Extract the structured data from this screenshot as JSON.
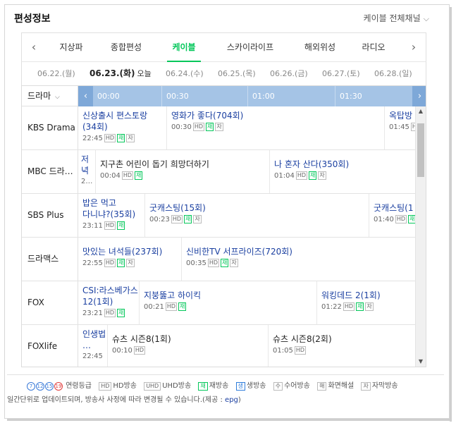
{
  "header": {
    "title": "편성정보",
    "channel_select": "케이블 전체채널"
  },
  "categories": [
    {
      "label": "지상파",
      "active": false
    },
    {
      "label": "종합편성",
      "active": false
    },
    {
      "label": "케이블",
      "active": true
    },
    {
      "label": "스카이라이프",
      "active": false
    },
    {
      "label": "해외위성",
      "active": false
    },
    {
      "label": "라디오",
      "active": false
    }
  ],
  "dates": [
    {
      "label": "06.22.(월)"
    },
    {
      "label": "06.23.(화)",
      "today_label": "오늘"
    },
    {
      "label": "06.24.(수)"
    },
    {
      "label": "06.25.(목)"
    },
    {
      "label": "06.26.(금)"
    },
    {
      "label": "06.27.(토)"
    },
    {
      "label": "06.28.(일)"
    }
  ],
  "grid": {
    "genre": "드라마",
    "times": [
      "00:00",
      "00:30",
      "01:00",
      "01:30"
    ],
    "rows": [
      {
        "channel": "KBS Drama",
        "programs": [
          {
            "title": "신상출시 편스토랑(34회)",
            "time": "22:45",
            "badges": [
              "HD",
              "재",
              "자"
            ]
          },
          {
            "title": "영화가 좋다(704회)",
            "time": "00:30",
            "badges": [
              "HD",
              "재",
              "자"
            ]
          },
          {
            "title": "옥탑방",
            "time": "01:45",
            "badges": [
              "HD"
            ]
          }
        ]
      },
      {
        "channel": "MBC 드라…",
        "programs": [
          {
            "title": "저녁",
            "time": "2…",
            "badges": []
          },
          {
            "title": "지구촌 어린이 돕기 희망더하기",
            "time": "00:04",
            "badges": [
              "HD",
              "재"
            ]
          },
          {
            "title": "나 혼자 산다(350회)",
            "time": "01:04",
            "badges": [
              "HD",
              "재",
              "자"
            ]
          }
        ]
      },
      {
        "channel": "SBS Plus",
        "programs": [
          {
            "title": "밥은 먹고 다니냐?(35회)",
            "time": "23:11",
            "badges": [
              "HD",
              "재"
            ]
          },
          {
            "title": "굿캐스팅(15회)",
            "time": "00:23",
            "badges": [
              "HD",
              "재",
              "자"
            ]
          },
          {
            "title": "굿캐스팅(1",
            "time": "01:40",
            "badges": [
              "HD",
              "재"
            ]
          }
        ]
      },
      {
        "channel": "드라맥스",
        "programs": [
          {
            "title": "맛있는 녀석들(237회)",
            "time": "22:55",
            "badges": [
              "HD",
              "재",
              "자"
            ]
          },
          {
            "title": "신비한TV 서프라이즈(720회)",
            "time": "00:35",
            "badges": [
              "HD",
              "재",
              "자"
            ]
          }
        ]
      },
      {
        "channel": "FOX",
        "programs": [
          {
            "title": "CSI:라스베가스 12(1회)",
            "time": "23:21",
            "badges": [
              "HD",
              "재"
            ]
          },
          {
            "title": "지붕뚫고 하이킥",
            "time": "00:21",
            "badges": [
              "HD",
              "재"
            ]
          },
          {
            "title": "워킹데드 2(1회)",
            "time": "01:22",
            "badges": [
              "HD",
              "재",
              "자"
            ]
          }
        ]
      },
      {
        "channel": "FOXlife",
        "programs": [
          {
            "title": "인생법…",
            "time": "22:45",
            "badges": []
          },
          {
            "title": "슈츠 시즌8(1회)",
            "time": "00:10",
            "badges": [
              "HD"
            ]
          },
          {
            "title": "슈츠 시즌8(2회)",
            "time": "01:05",
            "badges": [
              "HD"
            ]
          }
        ]
      }
    ]
  },
  "legend": {
    "ages": [
      "7",
      "12",
      "15",
      "19"
    ],
    "age_label": "연령등급",
    "items": [
      {
        "badge": "HD",
        "label": "HD방송"
      },
      {
        "badge": "UHD",
        "label": "UHD방송"
      },
      {
        "badge": "재",
        "label": "재방송"
      },
      {
        "badge": "생",
        "label": "생방송"
      },
      {
        "badge": "수",
        "label": "수어방송"
      },
      {
        "badge": "해",
        "label": "화면해설"
      },
      {
        "badge": "자",
        "label": "자막방송"
      }
    ]
  },
  "note": {
    "text": "일간단위로 업데이트되며, 방송사 사정에 따라 변경될 수 있습니다.(제공 : ",
    "source": "epg",
    "close": ")"
  }
}
